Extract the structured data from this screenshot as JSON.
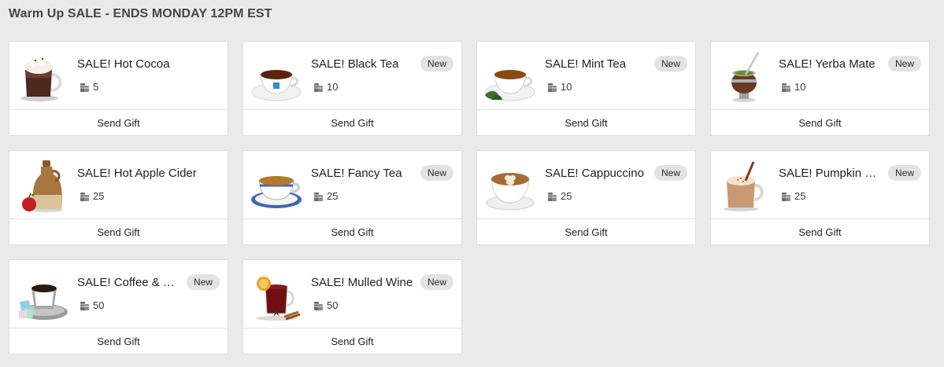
{
  "page": {
    "title": "Warm Up SALE - ENDS MONDAY 12PM EST"
  },
  "gifts": [
    {
      "name": "SALE! Hot Cocoa",
      "price": "5",
      "badge": "",
      "send_label": "Send Gift",
      "icon": "hot-cocoa-mug-icon"
    },
    {
      "name": "SALE! Black Tea",
      "price": "10",
      "badge": "New",
      "send_label": "Send Gift",
      "icon": "black-tea-cup-icon"
    },
    {
      "name": "SALE! Mint Tea",
      "price": "10",
      "badge": "New",
      "send_label": "Send Gift",
      "icon": "mint-tea-cup-icon"
    },
    {
      "name": "SALE! Yerba Mate",
      "price": "10",
      "badge": "New",
      "send_label": "Send Gift",
      "icon": "yerba-mate-gourd-icon"
    },
    {
      "name": "SALE! Hot Apple Cider",
      "price": "25",
      "badge": "",
      "send_label": "Send Gift",
      "icon": "apple-cider-jug-icon"
    },
    {
      "name": "SALE! Fancy Tea",
      "price": "25",
      "badge": "New",
      "send_label": "Send Gift",
      "icon": "fancy-tea-cup-icon"
    },
    {
      "name": "SALE! Cappuccino",
      "price": "25",
      "badge": "New",
      "send_label": "Send Gift",
      "icon": "cappuccino-cup-icon"
    },
    {
      "name": "SALE! Pumpkin S…",
      "price": "25",
      "badge": "New",
      "send_label": "Send Gift",
      "icon": "pumpkin-spice-latte-icon"
    },
    {
      "name": "SALE! Coffee & Tu…",
      "price": "50",
      "badge": "New",
      "send_label": "Send Gift",
      "icon": "turkish-coffee-icon"
    },
    {
      "name": "SALE! Mulled Wine",
      "price": "50",
      "badge": "New",
      "send_label": "Send Gift",
      "icon": "mulled-wine-glass-icon"
    }
  ]
}
